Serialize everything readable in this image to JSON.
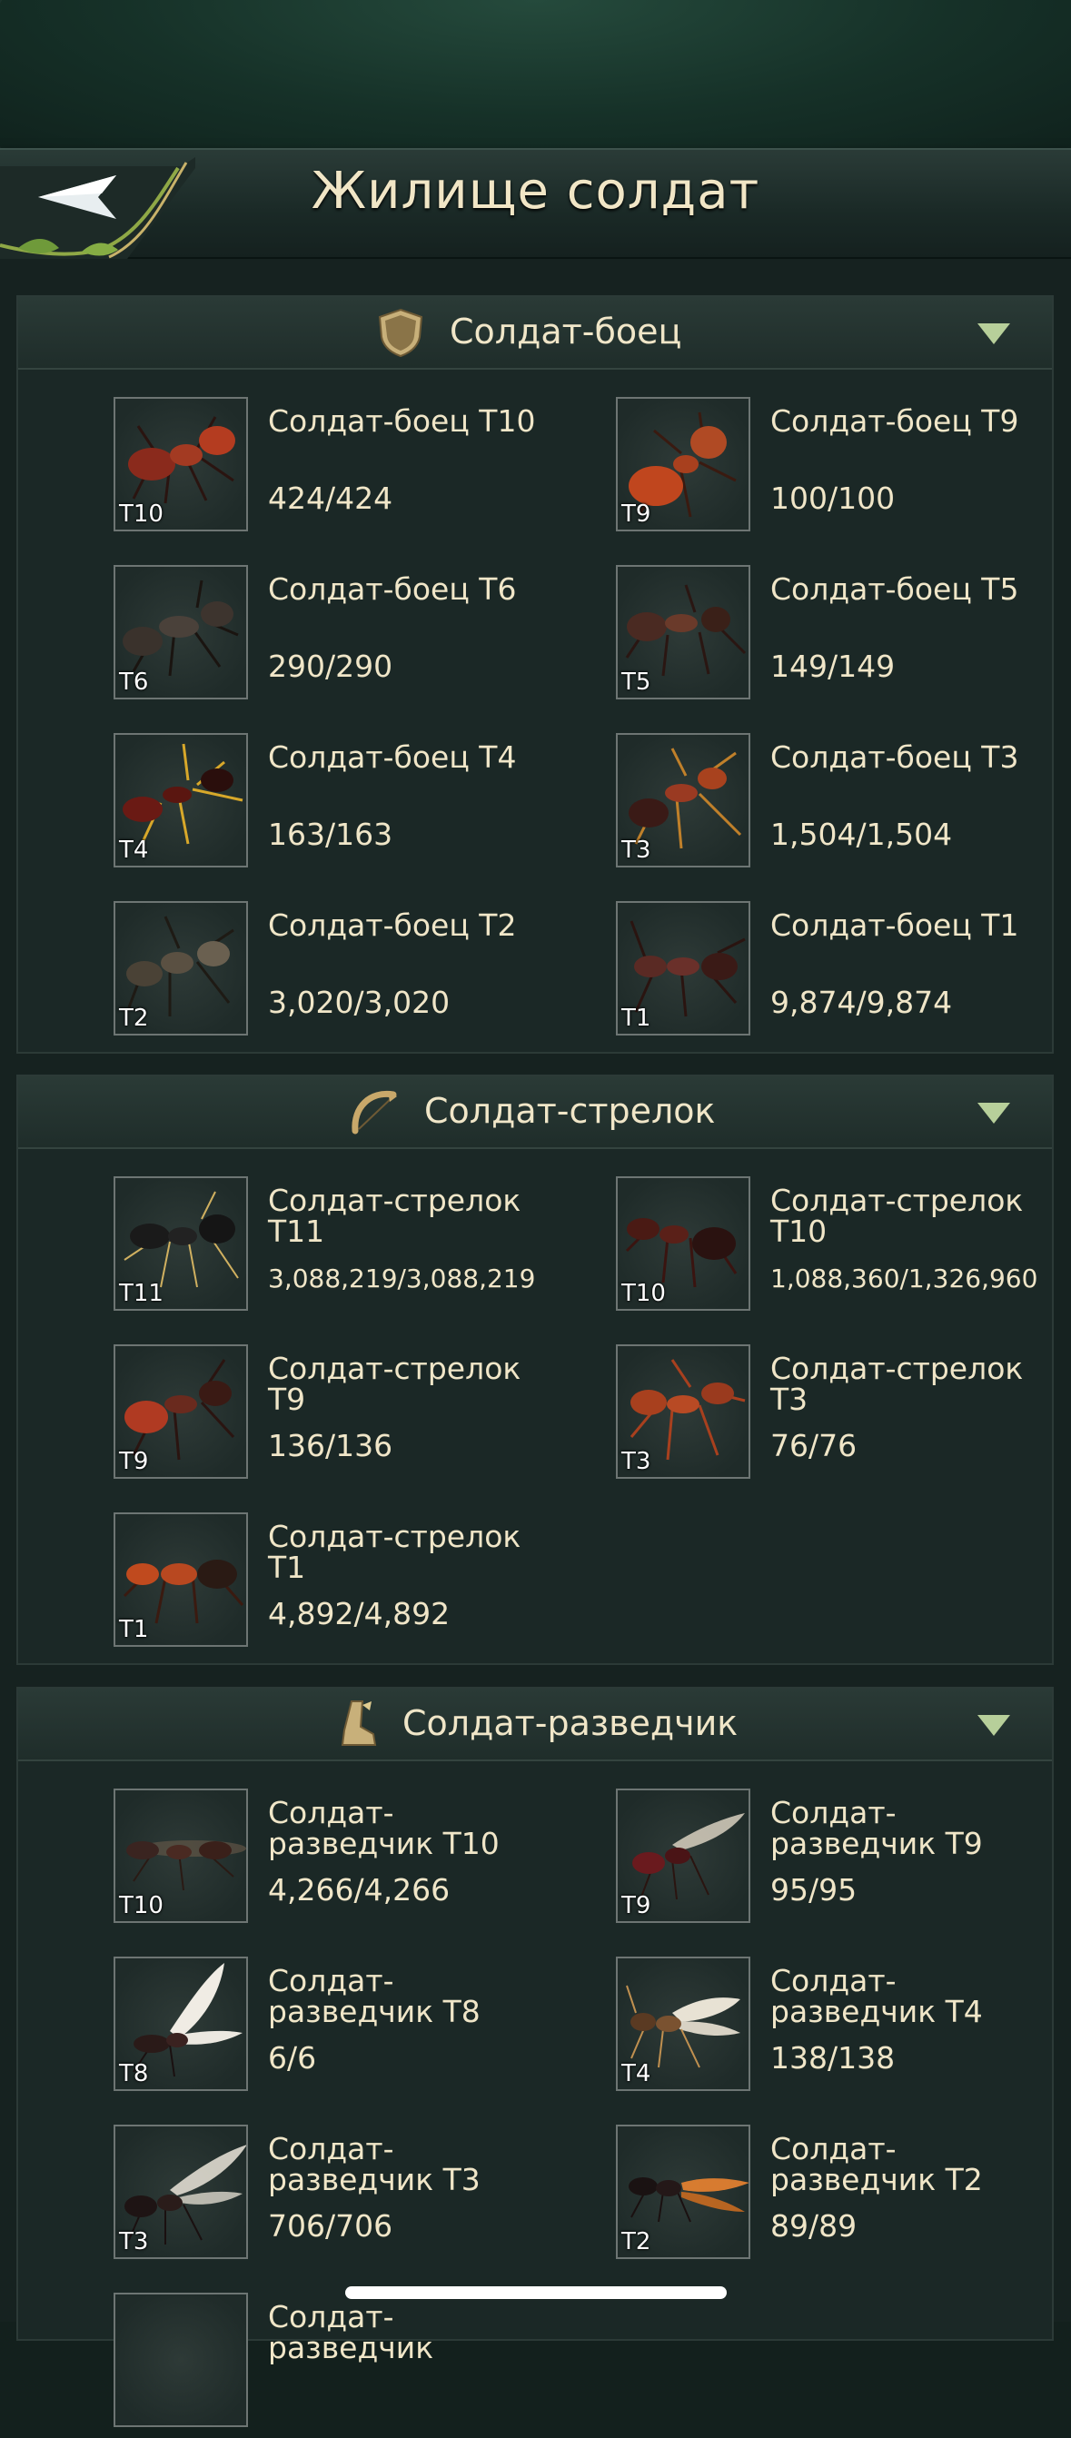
{
  "header": {
    "title": "Жилище солдат",
    "back_icon": "back-arrow-icon"
  },
  "colors": {
    "accent_text": "#f0e6c8",
    "panel": "#1b2826",
    "chevron": "#b7cf9a"
  },
  "sections": [
    {
      "title": "Солдат-боец",
      "icon": "shield-icon",
      "units": [
        {
          "name": "Солдат-боец T10",
          "count": "424/424",
          "tier": "T10"
        },
        {
          "name": "Солдат-боец T9",
          "count": "100/100",
          "tier": "T9"
        },
        {
          "name": "Солдат-боец T6",
          "count": "290/290",
          "tier": "T6"
        },
        {
          "name": "Солдат-боец T5",
          "count": "149/149",
          "tier": "T5"
        },
        {
          "name": "Солдат-боец T4",
          "count": "163/163",
          "tier": "T4"
        },
        {
          "name": "Солдат-боец T3",
          "count": "1,504/1,504",
          "tier": "T3"
        },
        {
          "name": "Солдат-боец T2",
          "count": "3,020/3,020",
          "tier": "T2"
        },
        {
          "name": "Солдат-боец T1",
          "count": "9,874/9,874",
          "tier": "T1"
        }
      ]
    },
    {
      "title": "Солдат-стрелок",
      "icon": "bow-icon",
      "units": [
        {
          "name": "Солдат-стрелок T11",
          "count": "3,088,219/3,088,219",
          "tier": "T11"
        },
        {
          "name": "Солдат-стрелок T10",
          "count": "1,088,360/1,326,960",
          "tier": "T10"
        },
        {
          "name": "Солдат-стрелок T9",
          "count": "136/136",
          "tier": "T9"
        },
        {
          "name": "Солдат-стрелок T3",
          "count": "76/76",
          "tier": "T3"
        },
        {
          "name": "Солдат-стрелок T1",
          "count": "4,892/4,892",
          "tier": "T1"
        }
      ]
    },
    {
      "title": "Солдат-разведчик",
      "icon": "boot-icon",
      "units": [
        {
          "name": "Солдат-разведчик T10",
          "count": "4,266/4,266",
          "tier": "T10"
        },
        {
          "name": "Солдат-разведчик T9",
          "count": "95/95",
          "tier": "T9"
        },
        {
          "name": "Солдат-разведчик T8",
          "count": "6/6",
          "tier": "T8"
        },
        {
          "name": "Солдат-разведчик T4",
          "count": "138/138",
          "tier": "T4"
        },
        {
          "name": "Солдат-разведчик T3",
          "count": "706/706",
          "tier": "T3"
        },
        {
          "name": "Солдат-разведчик T2",
          "count": "89/89",
          "tier": "T2"
        },
        {
          "name": "Солдат-разведчик",
          "count": "",
          "tier": ""
        }
      ]
    }
  ]
}
